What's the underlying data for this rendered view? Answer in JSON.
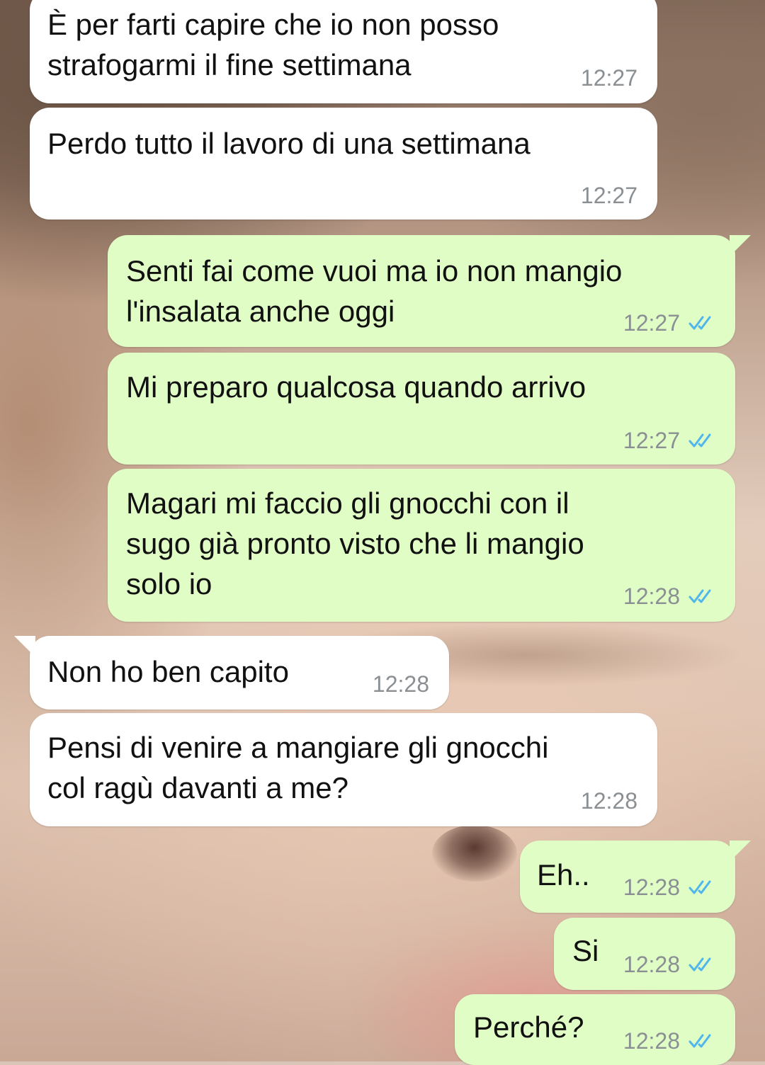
{
  "messages": [
    {
      "direction": "incoming",
      "text": "È per farti capire che io non posso\nstrafogarmi il fine settimana",
      "time": "12:27"
    },
    {
      "direction": "incoming",
      "text": "Perdo tutto il lavoro di una settimana",
      "time": "12:27"
    },
    {
      "direction": "outgoing",
      "text": "Senti fai come vuoi ma io non mangio\nl'insalata anche oggi",
      "time": "12:27",
      "status": "read"
    },
    {
      "direction": "outgoing",
      "text": "Mi preparo qualcosa quando arrivo",
      "time": "12:27",
      "status": "read"
    },
    {
      "direction": "outgoing",
      "text": "Magari mi faccio gli gnocchi con il\nsugo già pronto visto che li mangio\nsolo io",
      "time": "12:28",
      "status": "read"
    },
    {
      "direction": "incoming",
      "text": "Non ho ben capito",
      "time": "12:28"
    },
    {
      "direction": "incoming",
      "text": "Pensi di venire a mangiare gli gnocchi\ncol ragù davanti a me?",
      "time": "12:28"
    },
    {
      "direction": "outgoing",
      "text": "Eh..",
      "time": "12:28",
      "status": "read"
    },
    {
      "direction": "outgoing",
      "text": "Si",
      "time": "12:28",
      "status": "read"
    },
    {
      "direction": "outgoing",
      "text": "Perché?",
      "time": "12:28",
      "status": "read"
    }
  ],
  "colors": {
    "incoming_bubble": "#ffffff",
    "outgoing_bubble": "#e1fdc6",
    "text": "#111111",
    "timestamp": "#8a8f93",
    "read_ticks": "#4fb6ec"
  },
  "icons": {
    "read_status": "double-check-icon"
  }
}
